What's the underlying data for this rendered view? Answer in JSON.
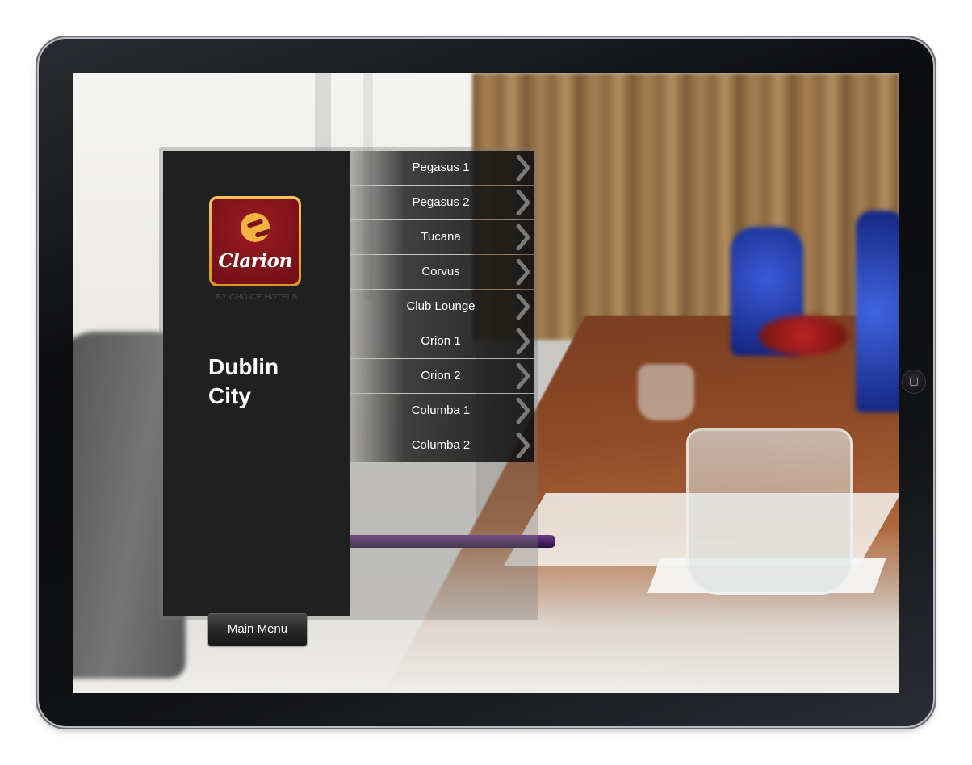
{
  "brand": {
    "logo_text": "Clarion",
    "sub_brand": "BY CHOICE HOTELS"
  },
  "hotel": {
    "name_line1": "Dublin",
    "name_line2": "City"
  },
  "rooms": [
    {
      "label": "Pegasus 1"
    },
    {
      "label": "Pegasus 2"
    },
    {
      "label": "Tucana"
    },
    {
      "label": "Corvus"
    },
    {
      "label": "Club Lounge"
    },
    {
      "label": "Orion 1"
    },
    {
      "label": "Orion 2"
    },
    {
      "label": "Columba 1"
    },
    {
      "label": "Columba 2"
    }
  ],
  "nav": {
    "main_menu_label": "Main Menu"
  },
  "icons": {
    "chevron": "chevron-right-icon",
    "home": "home-button-icon"
  },
  "colors": {
    "brand_red": "#8a1520",
    "brand_gold": "#f4b340",
    "sidebar_bg": "#202020"
  }
}
